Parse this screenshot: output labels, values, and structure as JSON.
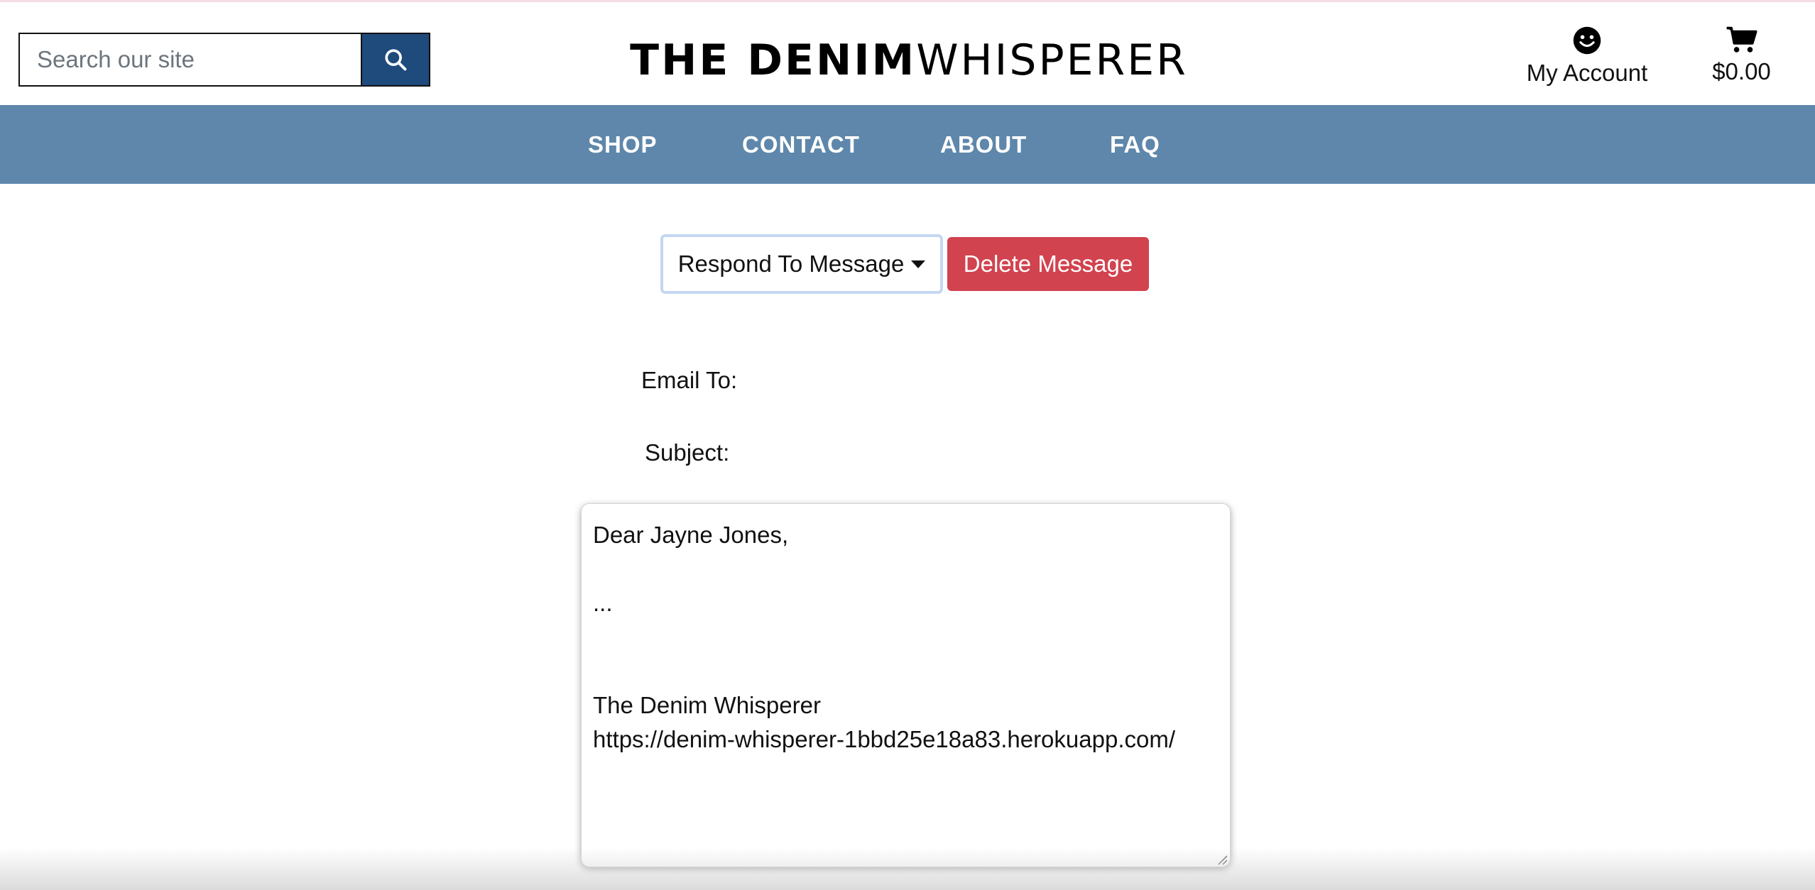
{
  "header": {
    "search": {
      "placeholder": "Search our site",
      "button_icon": "search-icon"
    },
    "logo": {
      "part1": "THE DENIM ",
      "part2": "WHISPERER"
    },
    "account": {
      "icon": "smiley-icon",
      "label": "My Account"
    },
    "cart": {
      "icon": "cart-icon",
      "total": "$0.00"
    }
  },
  "nav": {
    "items": [
      {
        "label": "SHOP"
      },
      {
        "label": "CONTACT"
      },
      {
        "label": "ABOUT"
      },
      {
        "label": "FAQ"
      }
    ]
  },
  "actions": {
    "respond_label": "Respond To Message",
    "delete_label": "Delete Message"
  },
  "form": {
    "email_to_label": "Email To:",
    "email_to_value": "",
    "subject_label": "Subject:",
    "subject_value": "",
    "message_body": "Dear Jayne Jones,\n\n...\n\n\nThe Denim Whisperer\nhttps://denim-whisperer-1bbd25e18a83.herokuapp.com/"
  },
  "colors": {
    "nav_background": "#5e87ab",
    "search_button": "#1f4a7c",
    "delete_button": "#d1434f",
    "focus_ring": "#c4d7f2"
  }
}
